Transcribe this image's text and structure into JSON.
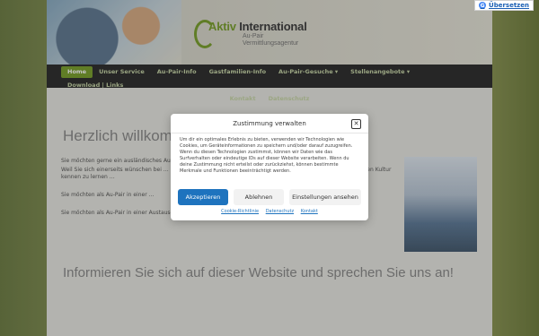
{
  "translate": {
    "label": "Übersetzen"
  },
  "header": {
    "logo_title_a": "Aktiv",
    "logo_title_b": " International",
    "logo_sub1": "Au-Pair",
    "logo_sub2": "Vermittlungsagentur"
  },
  "nav": {
    "items": [
      {
        "label": "Home",
        "active": true
      },
      {
        "label": "Unser Service"
      },
      {
        "label": "Au-Pair-Info"
      },
      {
        "label": "Gastfamilien-Info"
      },
      {
        "label": "Au-Pair-Gesuche ▾"
      },
      {
        "label": "Stellenangebote ▾"
      },
      {
        "label": "Download | Links"
      },
      {
        "label": "Kontakt"
      },
      {
        "label": "Datenschutz"
      }
    ]
  },
  "main": {
    "heading": "Herzlich willkommen",
    "para1": "Sie möchten gerne ein ausländisches Au-Pair …",
    "para2": "Weil Sie sich einerseits wünschen bei … Unterstützung zu bekommen, und andererseits einem … mit einer anderen Kultur kennen zu lernen …",
    "para3": "Sie möchten als Au-Pair in einer …",
    "para4": "Sie möchten als Au-Pair in einer Austauschland Familie … Erfahrungen sammeln?",
    "heading2": "Informieren Sie sich auf dieser Website und sprechen Sie uns an!"
  },
  "consent": {
    "title": "Zustimmung verwalten",
    "body": "Um dir ein optimales Erlebnis zu bieten, verwenden wir Technologien wie Cookies, um Geräteinformationen zu speichern und/oder darauf zuzugreifen. Wenn du diesen Technologien zustimmst, können wir Daten wie das Surfverhalten oder eindeutige IDs auf dieser Website verarbeiten. Wenn du deine Zustimmung nicht erteilst oder zurückziehst, können bestimmte Merkmale und Funktionen beeinträchtigt werden.",
    "accept": "Akzeptieren",
    "deny": "Ablehnen",
    "prefs": "Einstellungen ansehen",
    "links": [
      "Cookie-Richtlinie",
      "Datenschutz",
      "Kontakt"
    ]
  }
}
